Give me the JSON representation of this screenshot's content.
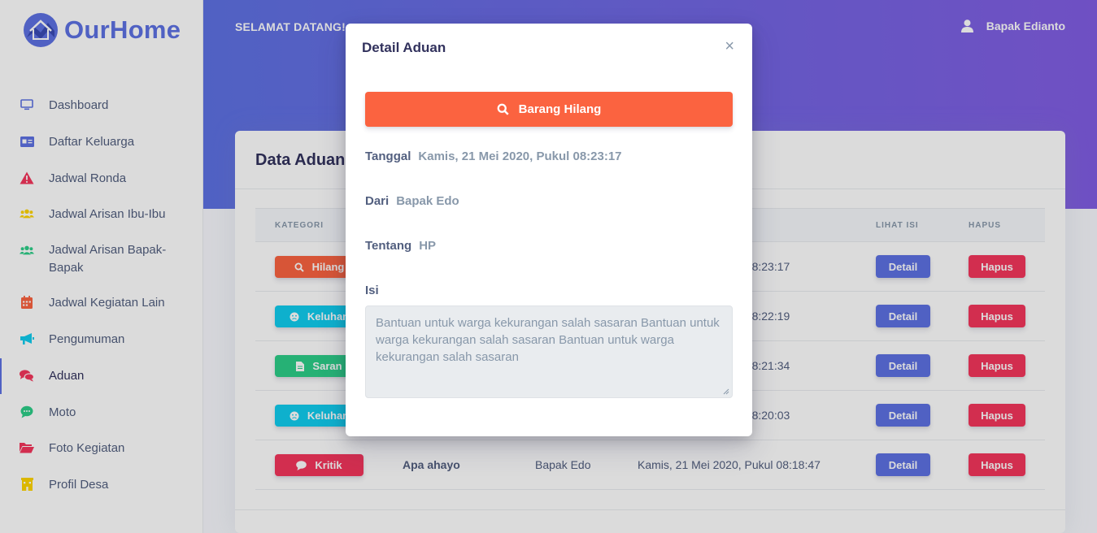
{
  "brand": {
    "name": "OurHome",
    "accent": "#5e72e4"
  },
  "sidebar": {
    "items": [
      {
        "label": "Dashboard",
        "icon": "monitor-icon",
        "color": "#5e72e4"
      },
      {
        "label": "Daftar Keluarga",
        "icon": "id-card-icon",
        "color": "#5e72e4"
      },
      {
        "label": "Jadwal Ronda",
        "icon": "warning-icon",
        "color": "#f5365c"
      },
      {
        "label": "Jadwal Arisan Ibu-Ibu",
        "icon": "users-icon",
        "color": "#ffd600"
      },
      {
        "label": "Jadwal Arisan Bapak-Bapak",
        "icon": "users-icon",
        "color": "#2dce89"
      },
      {
        "label": "Jadwal Kegiatan Lain",
        "icon": "calendar-icon",
        "color": "#fb6340"
      },
      {
        "label": "Pengumuman",
        "icon": "megaphone-icon",
        "color": "#11cdef"
      },
      {
        "label": "Aduan",
        "icon": "comments-icon",
        "color": "#f5365c",
        "active": true
      },
      {
        "label": "Moto",
        "icon": "chat-icon",
        "color": "#2dce89"
      },
      {
        "label": "Foto Kegiatan",
        "icon": "folder-icon",
        "color": "#f5365c"
      },
      {
        "label": "Profil Desa",
        "icon": "building-icon",
        "color": "#ffd600"
      }
    ]
  },
  "header": {
    "welcome": "SELAMAT DATANG!",
    "user_name": "Bapak Edianto"
  },
  "card": {
    "title": "Data Aduan",
    "columns": [
      "KATEGORI",
      "LIHAT ISI",
      "HAPUS"
    ],
    "rows": [
      {
        "category": "Hilang",
        "color": "#fb6340",
        "icon": "search-icon",
        "subject": "",
        "from": "",
        "date": "kul 08:23:17"
      },
      {
        "category": "Keluhan",
        "color": "#11cdef",
        "icon": "frown-icon",
        "subject": "",
        "from": "",
        "date": "kul 08:22:19"
      },
      {
        "category": "Saran",
        "color": "#2dce89",
        "icon": "file-icon",
        "subject": "",
        "from": "",
        "date": "kul 08:21:34"
      },
      {
        "category": "Keluhan",
        "color": "#11cdef",
        "icon": "frown-icon",
        "subject": "",
        "from": "",
        "date": "kul 08:20:03"
      },
      {
        "category": "Kritik",
        "color": "#f5365c",
        "icon": "comment-icon",
        "subject": "Apa ahayo",
        "from": "Bapak Edo",
        "date": "Kamis, 21 Mei 2020, Pukul 08:18:47"
      }
    ],
    "detail_label": "Detail",
    "delete_label": "Hapus"
  },
  "modal": {
    "title": "Detail Aduan",
    "close": "×",
    "category_banner": "Barang Hilang",
    "banner_color": "#fb6340",
    "tanggal_label": "Tanggal",
    "tanggal_value": "Kamis, 21 Mei 2020, Pukul 08:23:17",
    "dari_label": "Dari",
    "dari_value": "Bapak Edo",
    "tentang_label": "Tentang",
    "tentang_value": "HP",
    "isi_label": "Isi",
    "isi_value": "Bantuan untuk warga kekurangan salah sasaran Bantuan untuk warga kekurangan salah sasaran Bantuan untuk warga kekurangan salah sasaran"
  }
}
